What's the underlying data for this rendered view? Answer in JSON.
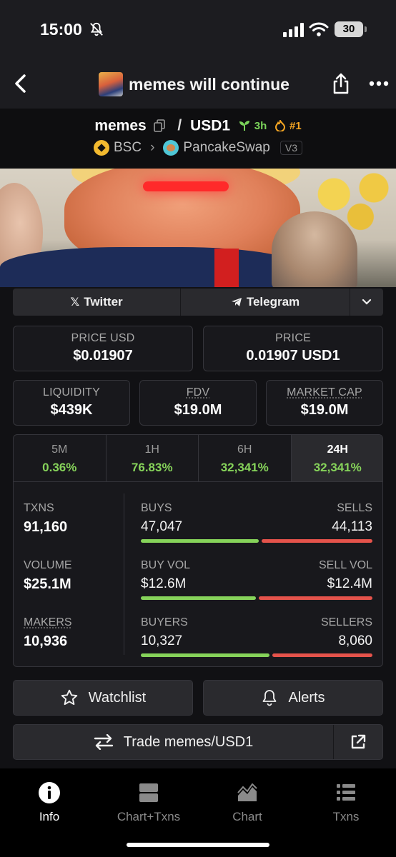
{
  "status_bar": {
    "time": "15:00",
    "battery": "30"
  },
  "nav": {
    "title": "memes will continue"
  },
  "pair": {
    "base": "memes",
    "separator": "/",
    "quote": "USD1",
    "age": "3h",
    "rank": "#1",
    "chain": "BSC",
    "dex": "PancakeSwap",
    "version": "V3"
  },
  "social": {
    "twitter": "Twitter",
    "telegram": "Telegram"
  },
  "price": {
    "usd_label": "PRICE USD",
    "usd_value": "$0.01907",
    "native_label": "PRICE",
    "native_value": "0.01907 USD1"
  },
  "metrics": {
    "liquidity_label": "LIQUIDITY",
    "liquidity_value": "$439K",
    "fdv_label": "FDV",
    "fdv_value": "$19.0M",
    "mcap_label": "MARKET CAP",
    "mcap_value": "$19.0M"
  },
  "timeframes": [
    {
      "label": "5M",
      "change": "0.36%"
    },
    {
      "label": "1H",
      "change": "76.83%"
    },
    {
      "label": "6H",
      "change": "32,341%"
    },
    {
      "label": "24H",
      "change": "32,341%"
    }
  ],
  "stats": {
    "txns_label": "TXNS",
    "txns_value": "91,160",
    "volume_label": "VOLUME",
    "volume_value": "$25.1M",
    "makers_label": "MAKERS",
    "makers_value": "10,936",
    "buys_label": "BUYS",
    "buys_value": "47,047",
    "sells_label": "SELLS",
    "sells_value": "44,113",
    "buy_vol_label": "BUY VOL",
    "buy_vol_value": "$12.6M",
    "sell_vol_label": "SELL VOL",
    "sell_vol_value": "$12.4M",
    "buyers_label": "BUYERS",
    "buyers_value": "10,327",
    "sellers_label": "SELLERS",
    "sellers_value": "8,060",
    "buy_share": 0.516,
    "buy_vol_share": 0.504,
    "buyers_share": 0.562
  },
  "actions": {
    "watchlist": "Watchlist",
    "alerts": "Alerts",
    "trade": "Trade memes/USD1"
  },
  "tabbar": [
    {
      "label": "Info",
      "icon": "info-icon"
    },
    {
      "label": "Chart+Txns",
      "icon": "split-view-icon"
    },
    {
      "label": "Chart",
      "icon": "area-chart-icon"
    },
    {
      "label": "Txns",
      "icon": "list-icon"
    }
  ],
  "colors": {
    "positive": "#86d35a",
    "negative": "#e5534b",
    "age": "#7bd35a",
    "rank": "#f5a623"
  }
}
